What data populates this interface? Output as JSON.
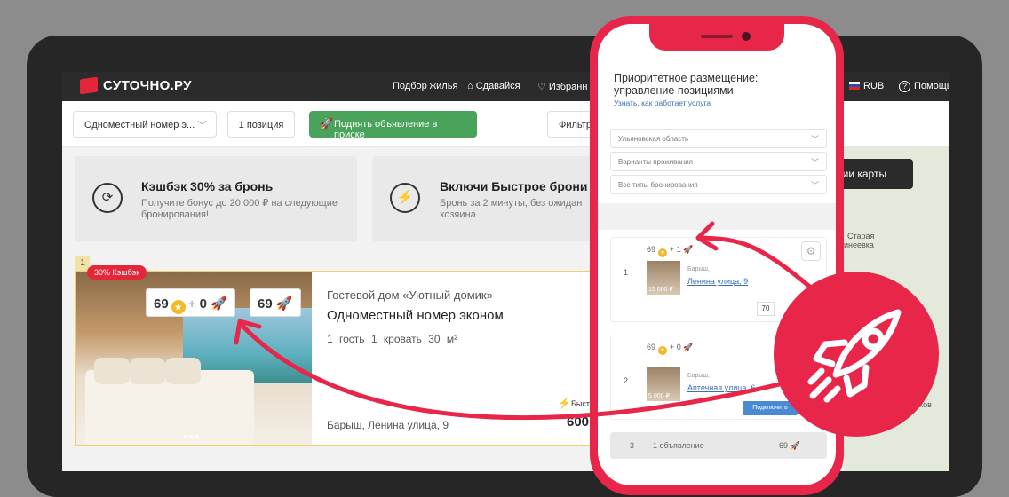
{
  "header": {
    "logo": "СУТОЧНО.РУ",
    "nav": [
      "Подбор жилья",
      "Сдавайся",
      "Избранн"
    ],
    "currency": "RUB",
    "help": "Помощь"
  },
  "toolbar": {
    "room_select": "Одноместный номер э...",
    "positions": "1 позиция",
    "boost_button": "Поднять объявление в поиске",
    "filter": "Фильтр"
  },
  "promos": [
    {
      "title": "Кэшбэк 30% за бронь",
      "desc": "Получите бонус до 20 000 ₽ на следующие бронирования!"
    },
    {
      "title": "Включи Быстрое брони",
      "desc": "Бронь за 2 минуты, без ожидан хозяина"
    }
  ],
  "map": {
    "button": "нии карты",
    "place1": "Старая",
    "place2": "инеевка",
    "place3": "иков"
  },
  "listing": {
    "index": "1",
    "cashback": "30% Кэшбэк",
    "score_a": "69",
    "plus": "+",
    "score_b": "0",
    "score_c": "69",
    "type": "Гостевой дом «Уютный домик»",
    "name": "Одноместный номер эконом",
    "guests": "1 гость",
    "beds": "1 кровать",
    "area": "30 м²",
    "address": "Барыш, Ленина улица, 9",
    "fast_label": "Быстр",
    "price": "600"
  },
  "phone": {
    "title": "Приоритетное размещение: управление позициями",
    "link": "Узнать, как работает услуга",
    "selects": [
      "Ульяновская область",
      "Варианты проживания",
      "Все типы бронирования"
    ],
    "items": [
      {
        "num": "1",
        "score": "69",
        "plus": "+ 1",
        "price": "15 000 ₽",
        "city": "Барыш,",
        "street": "Ленина улица, 9",
        "box": "70"
      },
      {
        "num": "2",
        "score": "69",
        "plus": "+ 0",
        "price": "5 000 ₽",
        "city": "Барыш,",
        "street": "Аптечная улица, 6",
        "button": "Подключить"
      }
    ],
    "footer": {
      "num": "3",
      "text": "1 объявление",
      "score": "69"
    }
  }
}
